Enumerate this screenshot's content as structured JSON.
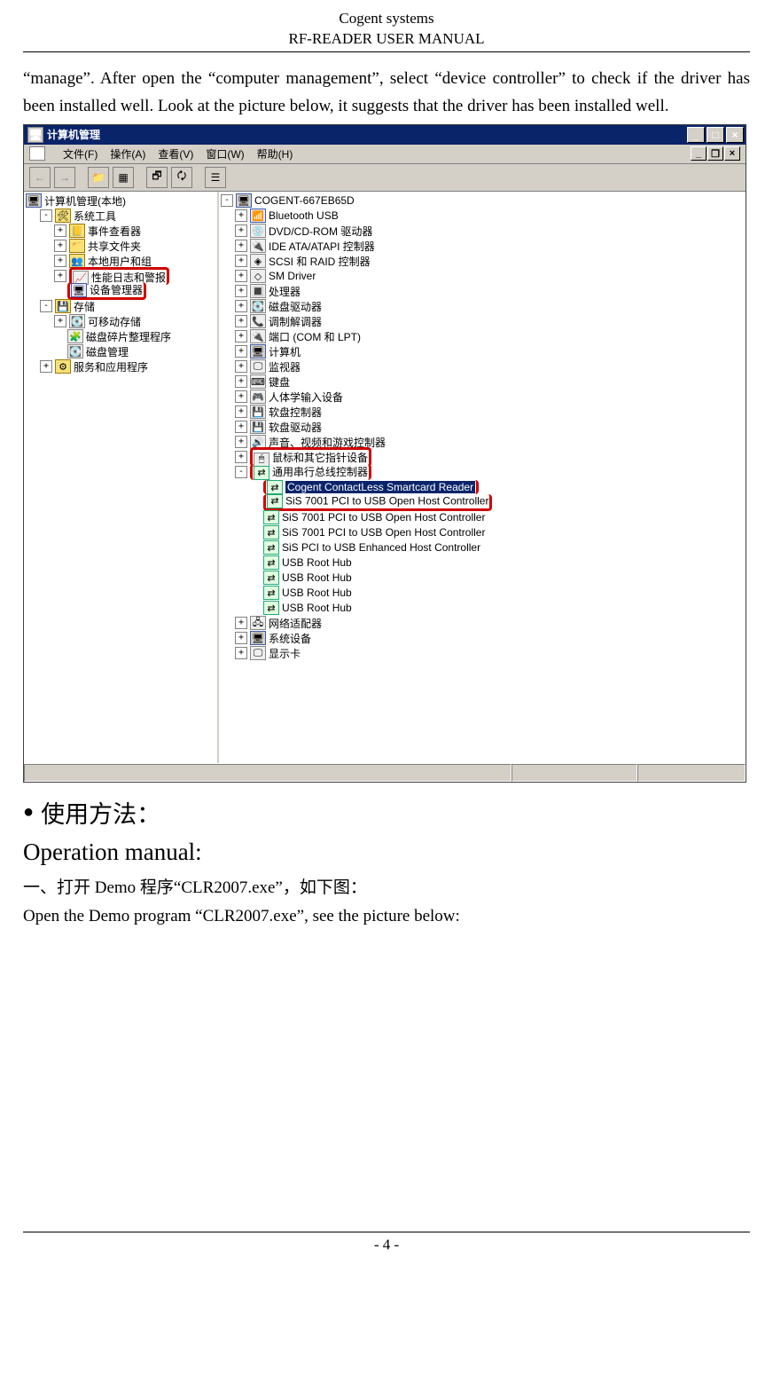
{
  "header": {
    "line1": "Cogent systems",
    "line2": "RF-READER USER MANUAL"
  },
  "intro_paragraph": "“manage”. After open the “computer management”, select “device controller” to check if the driver has been installed well. Look at the picture below, it suggests that the driver has been installed well.",
  "window": {
    "title": "计算机管理",
    "menus": {
      "file": "文件(F)",
      "action": "操作(A)",
      "view": "查看(V)",
      "window": "窗口(W)",
      "help": "帮助(H)"
    },
    "left_tree": {
      "root": "计算机管理(本地)",
      "sys_tools": "系统工具",
      "event_viewer": "事件查看器",
      "shared_folders": "共享文件夹",
      "local_users": "本地用户和组",
      "perf_logs": "性能日志和警报",
      "device_mgr": "设备管理器",
      "storage": "存储",
      "removable": "可移动存储",
      "defrag": "磁盘碎片整理程序",
      "disk_mgmt": "磁盘管理",
      "services": "服务和应用程序"
    },
    "right_tree": {
      "root": "COGENT-667EB65D",
      "bluetooth": "Bluetooth USB",
      "dvd": "DVD/CD-ROM 驱动器",
      "ide": "IDE ATA/ATAPI 控制器",
      "scsi": "SCSI 和 RAID 控制器",
      "sm": "SM Driver",
      "cpu": "处理器",
      "disk_drv": "磁盘驱动器",
      "modem": "调制解调器",
      "ports": "端口 (COM 和 LPT)",
      "computer": "计算机",
      "monitor": "监视器",
      "keyboard": "键盘",
      "hid": "人体学输入设备",
      "floppy_ctrl": "软盘控制器",
      "floppy_drv": "软盘驱动器",
      "sound": "声音、视频和游戏控制器",
      "mouse": "鼠标和其它指针设备",
      "usb_ctrl": "通用串行总线控制器",
      "cogent_reader": "Cogent ContactLess Smartcard Reader",
      "sis1": "SiS 7001 PCI to USB Open Host Controller",
      "sis2": "SiS 7001 PCI to USB Open Host Controller",
      "sis3": "SiS 7001 PCI to USB Open Host Controller",
      "sis_enh": "SiS PCI to USB Enhanced Host Controller",
      "root_hub1": "USB Root Hub",
      "root_hub2": "USB Root Hub",
      "root_hub3": "USB Root Hub",
      "root_hub4": "USB Root Hub",
      "net": "网络适配器",
      "sys_dev": "系统设备",
      "display": "显示卡"
    }
  },
  "usage_heading": "使用方法：",
  "operation_manual": "Operation manual:",
  "demo_line_cn": "一、打开 Demo 程序“CLR2007.exe”，如下图：",
  "demo_line_en": "Open the Demo program  “CLR2007.exe”, see the picture below:",
  "footer": "- 4 -"
}
